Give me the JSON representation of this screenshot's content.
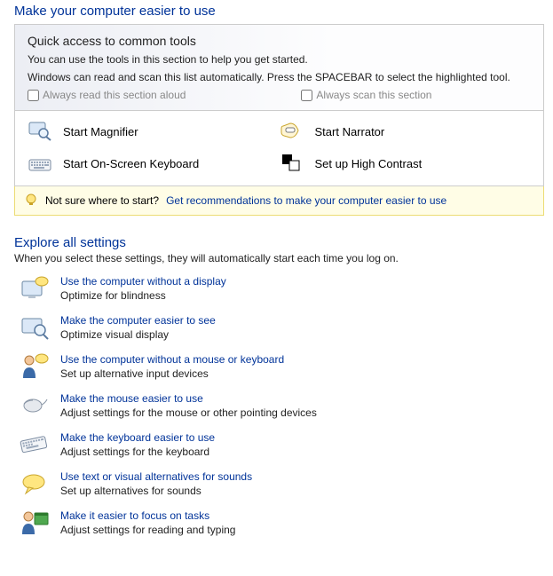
{
  "header": {
    "title": "Make your computer easier to use"
  },
  "quick": {
    "title": "Quick access to common tools",
    "line1": "You can use the tools in this section to help you get started.",
    "line2": "Windows can read and scan this list automatically.  Press the SPACEBAR to select the highlighted tool.",
    "cb_read": "Always read this section aloud",
    "cb_scan": "Always scan this section",
    "tools": [
      {
        "label": "Start Magnifier"
      },
      {
        "label": "Start Narrator"
      },
      {
        "label": "Start On-Screen Keyboard"
      },
      {
        "label": "Set up High Contrast"
      }
    ]
  },
  "tip": {
    "prefix": "Not sure where to start?  ",
    "link": "Get recommendations to make your computer easier to use"
  },
  "explore": {
    "title": "Explore all settings",
    "sub": "When you select these settings, they will automatically start each time you log on.",
    "items": [
      {
        "link": "Use the computer without a display",
        "desc": "Optimize for blindness"
      },
      {
        "link": "Make the computer easier to see",
        "desc": "Optimize visual display"
      },
      {
        "link": "Use the computer without a mouse or keyboard",
        "desc": "Set up alternative input devices"
      },
      {
        "link": "Make the mouse easier to use",
        "desc": "Adjust settings for the mouse or other pointing devices"
      },
      {
        "link": "Make the keyboard easier to use",
        "desc": "Adjust settings for the keyboard"
      },
      {
        "link": "Use text or visual alternatives for sounds",
        "desc": "Set up alternatives for sounds"
      },
      {
        "link": "Make it easier to focus on tasks",
        "desc": "Adjust settings for reading and typing"
      }
    ]
  }
}
